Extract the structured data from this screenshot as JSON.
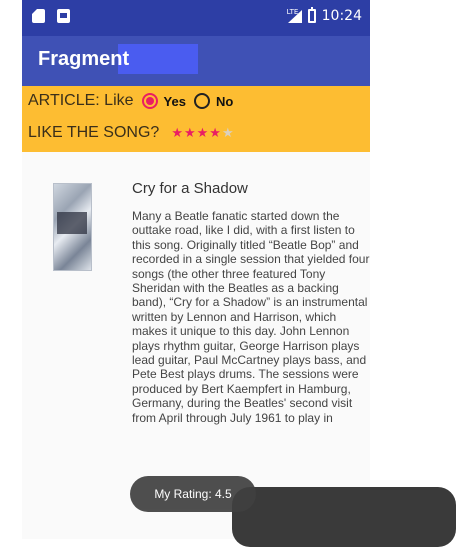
{
  "status_bar": {
    "time": "10:24",
    "network": "LTE",
    "icons": [
      "sd-card-icon",
      "message-icon",
      "signal-icon",
      "battery-icon"
    ]
  },
  "app_bar": {
    "title": "Fragment"
  },
  "article_like": {
    "label": "ARTICLE: Like",
    "options": [
      {
        "label": "Yes",
        "checked": true
      },
      {
        "label": "No",
        "checked": false
      }
    ]
  },
  "song_rating": {
    "label": "LIKE THE SONG?",
    "stars_filled": 4,
    "stars_total": 5
  },
  "song": {
    "title": "Cry for a Shadow",
    "description": "Many a Beatle fanatic started down the outtake road, like I did, with a first listen to this song. Originally titled “Beatle Bop” and recorded in a single session that yielded four songs (the other three featured Tony Sheridan with the Beatles as a backing band), “Cry for a Shadow” is an instrumental written by Lennon and Harrison, which makes it unique to this day. John Lennon plays rhythm guitar, George Harrison plays lead guitar, Paul McCartney plays bass, and Pete Best plays drums. The sessions were produced by Bert Kaempfert in Hamburg, Germany, during the Beatles' second visit from April through July 1961 to play in"
  },
  "toast": {
    "text": "My Rating: 4.5"
  },
  "colors": {
    "status_bar": "#2d3ea5",
    "app_bar": "#3f51b5",
    "header_panel": "#fdbd32",
    "accent": "#e91e63"
  }
}
